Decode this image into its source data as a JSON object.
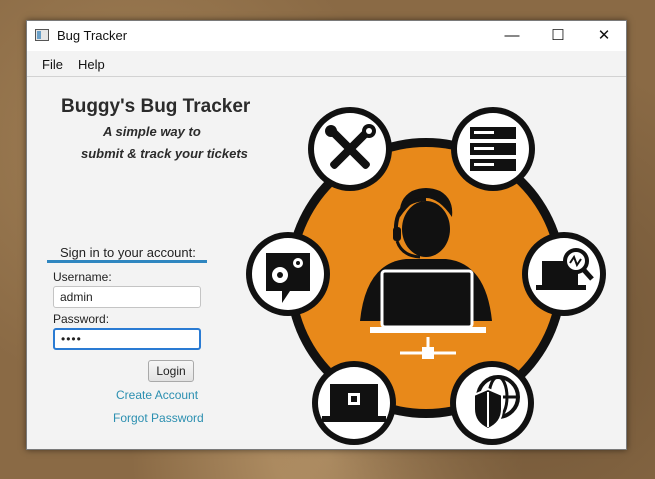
{
  "window": {
    "title": "Bug Tracker",
    "icon": "window-app-icon"
  },
  "controls": {
    "minimize": "—",
    "maximize": "☐",
    "close": "✕"
  },
  "menu": {
    "items": [
      "File",
      "Help"
    ]
  },
  "hero": {
    "title": "Buggy's Bug Tracker",
    "tagline_line1": "A simple way to",
    "tagline_line2": "submit & track your tickets"
  },
  "login": {
    "heading": "Sign in to your account:",
    "username_label": "Username:",
    "username_value": "admin",
    "password_label": "Password:",
    "password_value": "••••",
    "login_button": "Login",
    "create_account": "Create Account",
    "forgot_password": "Forgot Password"
  },
  "illustration": {
    "center": "support-agent-laptop-icon",
    "satellites": [
      "tools-icon",
      "server-rack-icon",
      "monitoring-laptop-icon",
      "security-globe-icon",
      "hardware-laptop-icon",
      "gear-chat-icon"
    ],
    "colors": {
      "orange": "#e8891a",
      "dark": "#111111",
      "white": "#ffffff"
    }
  }
}
